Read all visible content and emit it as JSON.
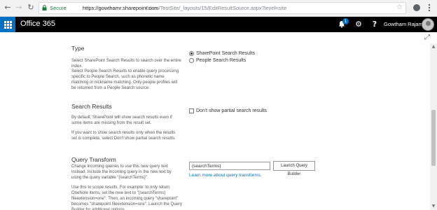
{
  "browser": {
    "back_icon": "arrow-left-icon",
    "forward_icon": "arrow-right-icon",
    "reload_icon": "reload-icon",
    "secure_label": "Secure",
    "url_host": "https://gowthamr.sharepoint.com",
    "url_path": "/sites/TestSite/_layouts/15/EditResultSource.aspx?level=site"
  },
  "suite": {
    "brand": "Office 365",
    "notification_count": "1",
    "user_name": "Gowtham Rajaman..."
  },
  "sections": {
    "type": {
      "heading": "Type",
      "desc1": "Select SharePoint Search Results to search over the entire index.",
      "desc2": "Select People Search Results to enable query processing specific to People Search, such as phonetic name matching or nickname matching. Only people profiles will be returned from a People Search source.",
      "options": [
        {
          "label": "SharePoint Search Results",
          "selected": true
        },
        {
          "label": "People Search Results",
          "selected": false
        }
      ]
    },
    "search_results": {
      "heading": "Search Results",
      "desc1": "By default, SharePoint will show search results even if some items are missing from the result set.",
      "desc2": "If you want to show search results only when the results set is complete, select Don't show partial search results.",
      "checkbox_label": "Don't show partial search results",
      "checked": false
    },
    "query_transform": {
      "heading": "Query Transform",
      "desc1": "Change incoming queries to use this new query text instead. Include the incoming query in the new text by using the query variable \"{searchTerms}\".",
      "desc2": "Use this to scope results. For example: to only return OneNote items, set the new text to \"{searchTerms} fileextension=one\". Then, an incoming query \"sharepoint\" becomes \"sharepoint fileextension=one\". Launch the Query Builder for additional options.",
      "input_value": "{searchTerms}",
      "button_label": "Launch Query Builder",
      "link_label": "Learn more about query transforms."
    }
  }
}
